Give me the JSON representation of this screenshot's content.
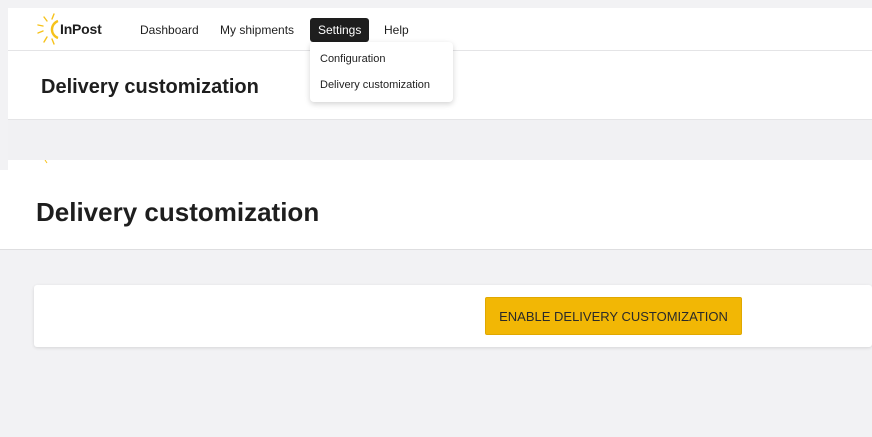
{
  "nav": {
    "logo": "InPost",
    "items": [
      "Dashboard",
      "My shipments",
      "Settings",
      "Help"
    ],
    "active": "Settings"
  },
  "dropdown": {
    "items": [
      "Configuration",
      "Delivery customization"
    ]
  },
  "page": {
    "header_title": "Delivery customization",
    "main_title": "Delivery customization",
    "enable_button": "ENABLE DELIVERY CUSTOMIZATION"
  },
  "colors": {
    "accent": "#f2b705",
    "dark": "#1e1e1e",
    "background": "#f2f2f4"
  }
}
